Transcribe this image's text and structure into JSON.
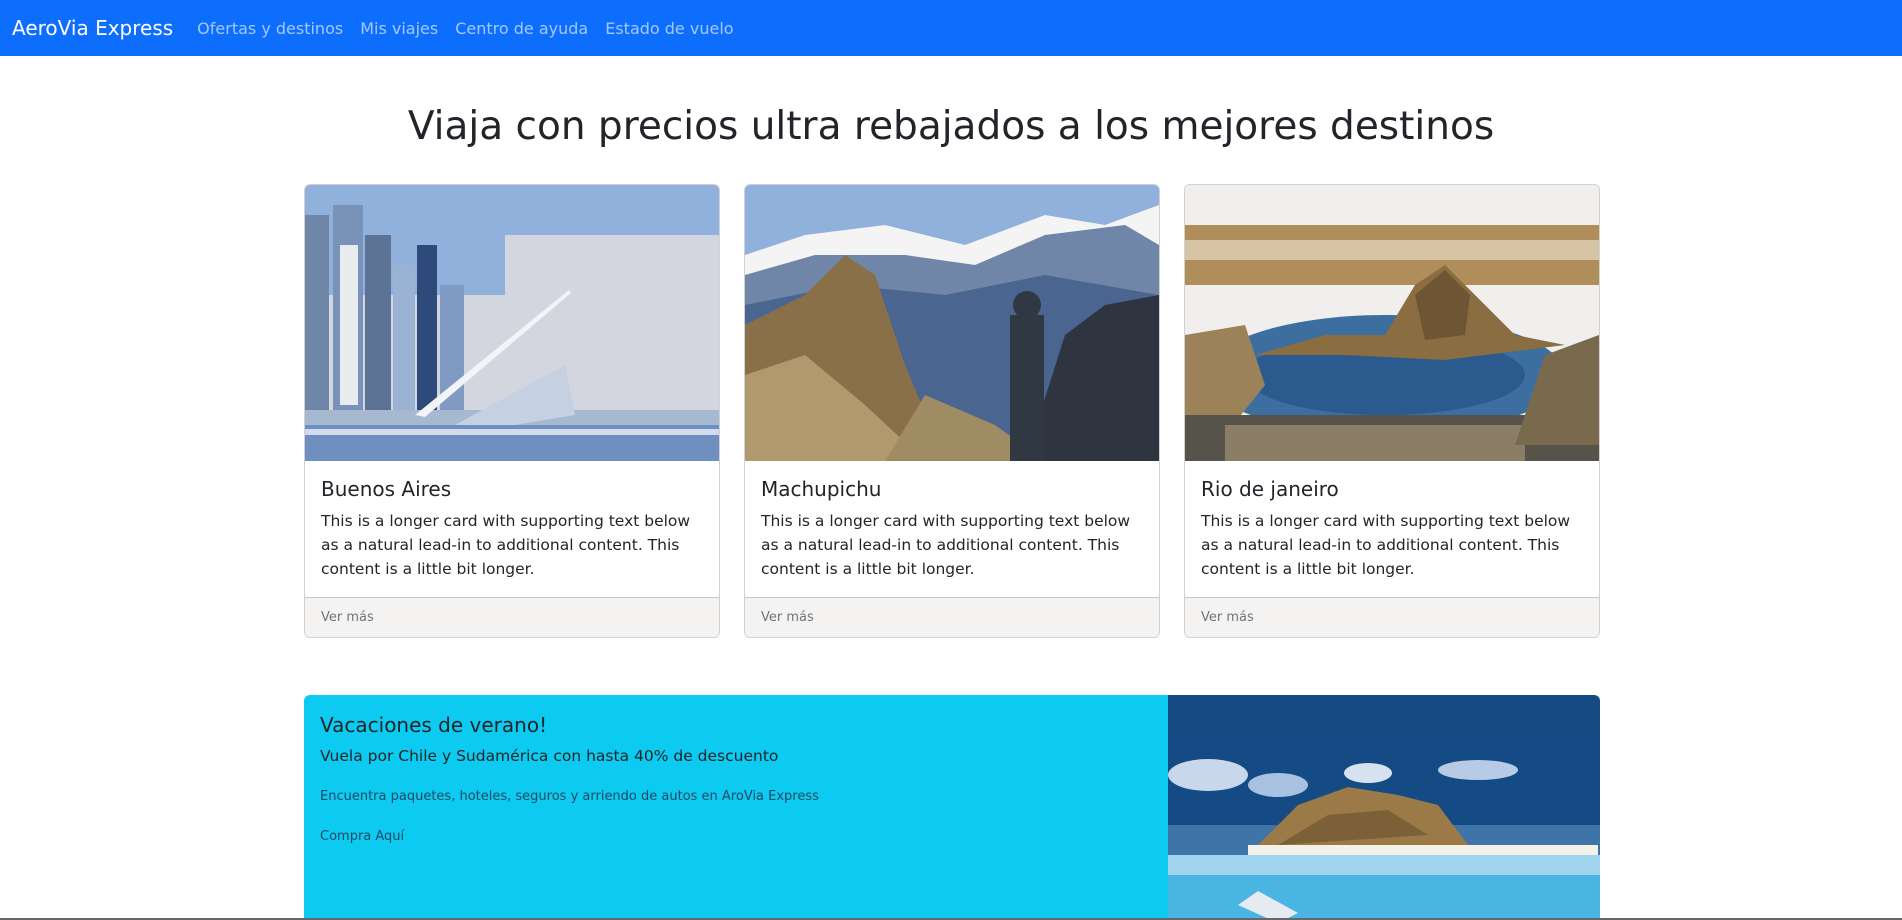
{
  "navbar": {
    "brand": "AeroVia Express",
    "links": [
      "Ofertas y destinos",
      "Mis viajes",
      "Centro de ayuda",
      "Estado de vuelo"
    ],
    "bg_color": "#0d6efd"
  },
  "hero": {
    "title": "Viaja con precios ultra rebajados a los mejores destinos"
  },
  "cards": [
    {
      "title": "Buenos Aires",
      "text": "This is a longer card with supporting text below as a natural lead-in to additional content. This content is a little bit longer.",
      "footer": "Ver más"
    },
    {
      "title": "Machupichu",
      "text": "This is a longer card with supporting text below as a natural lead-in to additional content. This content is a little bit longer.",
      "footer": "Ver más"
    },
    {
      "title": "Rio de janeiro",
      "text": "This is a longer card with supporting text below as a natural lead-in to additional content. This content is a little bit longer.",
      "footer": "Ver más"
    }
  ],
  "promo": {
    "title": "Vacaciones de verano!",
    "subtitle": "Vuela por Chile y Sudamérica con hasta 40% de descuento",
    "info": "Encuentra paquetes, hoteles, seguros y arriendo de autos en AroVia Express",
    "cta": "Compra Aquí",
    "bg_color": "#0dcaf0"
  }
}
